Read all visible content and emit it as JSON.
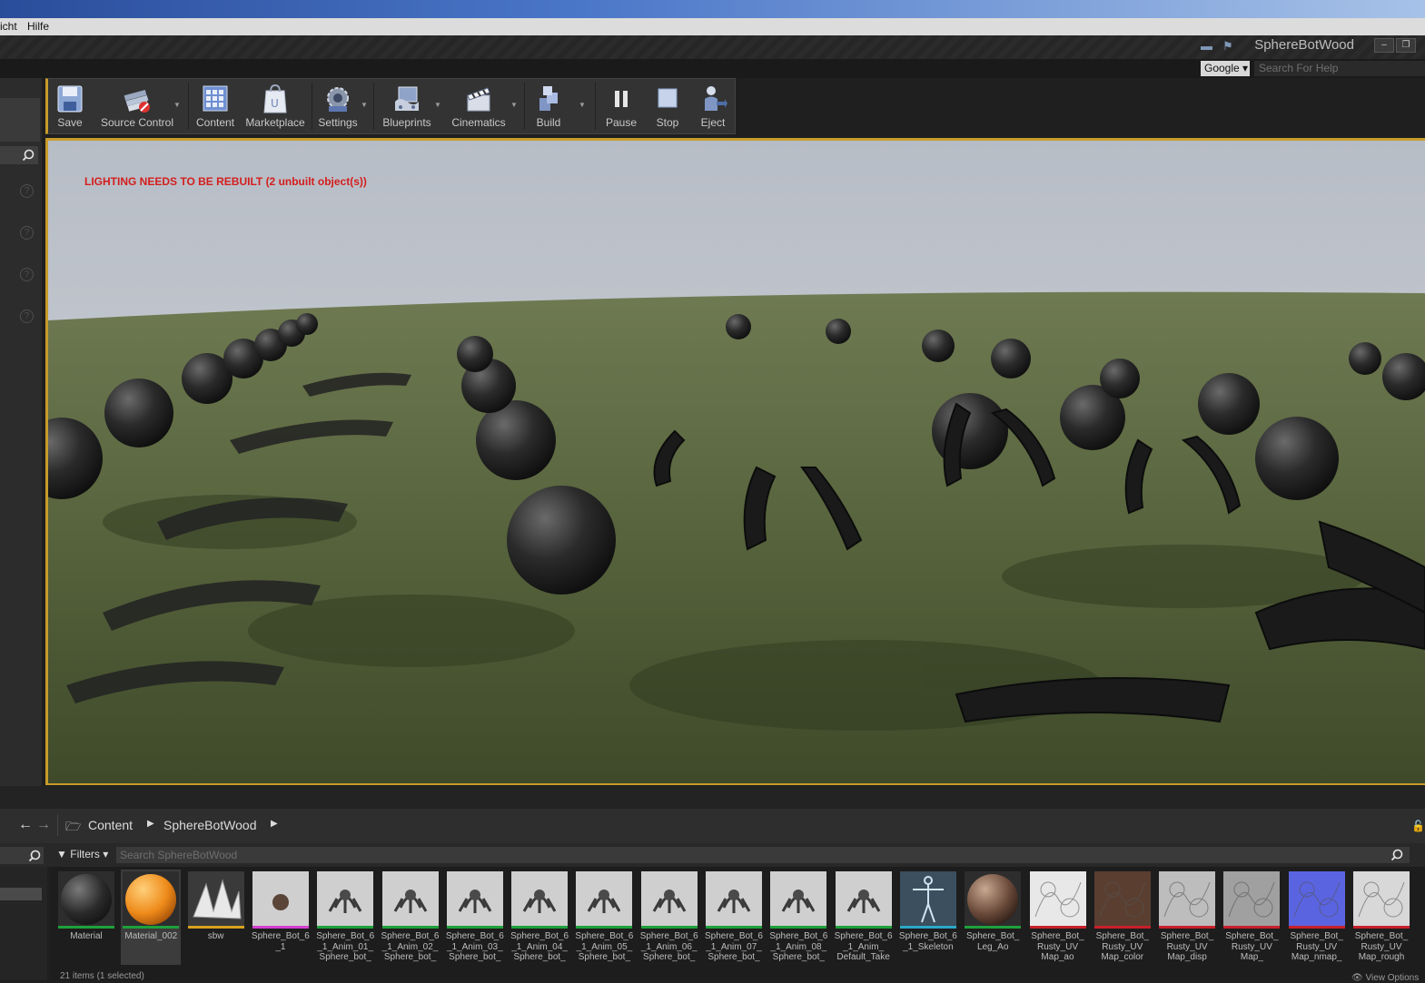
{
  "menu": [
    "icht",
    "Hilfe"
  ],
  "window": {
    "title": "SphereBotWood"
  },
  "help": {
    "provider": "Google",
    "placeholder": "Search For Help"
  },
  "toolbar": [
    {
      "id": "save",
      "label": "Save",
      "icon": "save-icon"
    },
    {
      "id": "source-control",
      "label": "Source Control",
      "icon": "source-control-icon"
    },
    {
      "id": "content",
      "label": "Content",
      "icon": "content-icon"
    },
    {
      "id": "marketplace",
      "label": "Marketplace",
      "icon": "marketplace-icon"
    },
    {
      "id": "settings",
      "label": "Settings",
      "icon": "settings-icon"
    },
    {
      "id": "blueprints",
      "label": "Blueprints",
      "icon": "blueprints-icon"
    },
    {
      "id": "cinematics",
      "label": "Cinematics",
      "icon": "cinematics-icon"
    },
    {
      "id": "build",
      "label": "Build",
      "icon": "build-icon"
    },
    {
      "id": "pause",
      "label": "Pause",
      "icon": "pause-icon"
    },
    {
      "id": "stop",
      "label": "Stop",
      "icon": "stop-icon"
    },
    {
      "id": "eject",
      "label": "Eject",
      "icon": "eject-icon"
    }
  ],
  "viewport": {
    "warning": "LIGHTING NEEDS TO BE REBUILT (2 unbuilt object(s))"
  },
  "content_browser": {
    "breadcrumb": [
      "Content",
      "SphereBotWood"
    ],
    "filters_label": "Filters",
    "search_placeholder": "Search SphereBotWood",
    "status": "21 items (1 selected)",
    "view_options": "View Options",
    "assets": [
      {
        "name": "Material",
        "kind": "material-dark",
        "color": "#1fa03a"
      },
      {
        "name": "Material_002",
        "kind": "material-orange",
        "color": "#1fa03a"
      },
      {
        "name": "sbw",
        "kind": "static-mesh",
        "color": "#d8a020"
      },
      {
        "name": "Sphere_Bot_6\n_1",
        "kind": "skeletal-mesh",
        "color": "#d43fd0"
      },
      {
        "name": "Sphere_Bot_6\n_1_Anim_01_\nSphere_bot_",
        "kind": "animation",
        "color": "#1fa03a"
      },
      {
        "name": "Sphere_Bot_6\n_1_Anim_02_\nSphere_bot_",
        "kind": "animation",
        "color": "#1fa03a"
      },
      {
        "name": "Sphere_Bot_6\n_1_Anim_03_\nSphere_bot_",
        "kind": "animation",
        "color": "#1fa03a"
      },
      {
        "name": "Sphere_Bot_6\n_1_Anim_04_\nSphere_bot_",
        "kind": "animation",
        "color": "#1fa03a"
      },
      {
        "name": "Sphere_Bot_6\n_1_Anim_05_\nSphere_bot_",
        "kind": "animation",
        "color": "#1fa03a"
      },
      {
        "name": "Sphere_Bot_6\n_1_Anim_06_\nSphere_bot_",
        "kind": "animation",
        "color": "#1fa03a"
      },
      {
        "name": "Sphere_Bot_6\n_1_Anim_07_\nSphere_bot_",
        "kind": "animation",
        "color": "#1fa03a"
      },
      {
        "name": "Sphere_Bot_6\n_1_Anim_08_\nSphere_bot_",
        "kind": "animation",
        "color": "#1fa03a"
      },
      {
        "name": "Sphere_Bot_6\n_1_Anim_\nDefault_Take",
        "kind": "animation",
        "color": "#1fa03a"
      },
      {
        "name": "Sphere_Bot_6\n_1_Skeleton",
        "kind": "skeleton",
        "color": "#2aa8c8"
      },
      {
        "name": "Sphere_Bot_\nLeg_Ao",
        "kind": "material-instance",
        "color": "#1fa03a"
      },
      {
        "name": "Sphere_Bot_\nRusty_UV\nMap_ao",
        "kind": "texture",
        "color": "#c8202a"
      },
      {
        "name": "Sphere_Bot_\nRusty_UV\nMap_color",
        "kind": "texture",
        "color": "#c8202a"
      },
      {
        "name": "Sphere_Bot_\nRusty_UV\nMap_disp",
        "kind": "texture",
        "color": "#c8202a"
      },
      {
        "name": "Sphere_Bot_\nRusty_UV\nMap_",
        "kind": "texture",
        "color": "#c8202a"
      },
      {
        "name": "Sphere_Bot_\nRusty_UV\nMap_nmap_",
        "kind": "texture",
        "color": "#c8202a"
      },
      {
        "name": "Sphere_Bot_\nRusty_UV\nMap_rough",
        "kind": "texture",
        "color": "#c8202a"
      }
    ]
  }
}
